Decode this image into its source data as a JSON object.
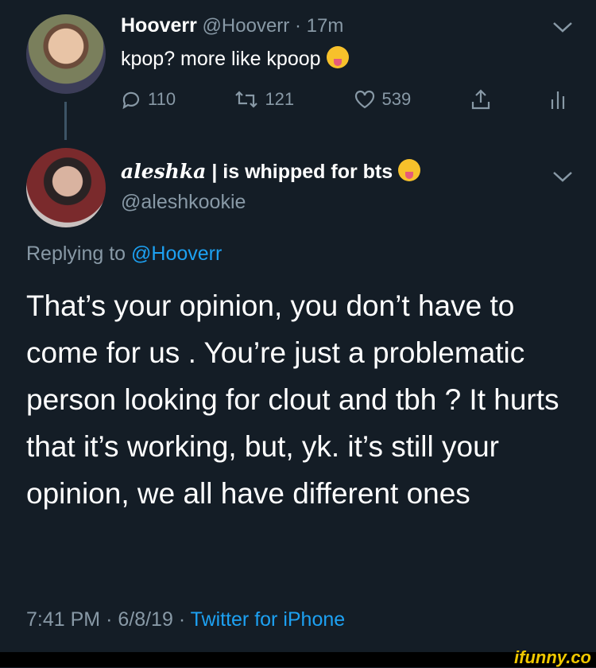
{
  "tweet1": {
    "name": "Hooverr",
    "handle": "@Hooverr",
    "separator": "·",
    "time": "17m",
    "text": "kpop? more like kpoop",
    "emoji": "rofl-emoji",
    "actions": {
      "replies": "110",
      "retweets": "121",
      "likes": "539"
    }
  },
  "tweet2": {
    "name_styled": "aleshka",
    "name_rest": "| is whipped for bts",
    "emoji": "tongue-out-emoji",
    "handle": "@aleshkookie",
    "replying_prefix": "Replying to",
    "replying_handle": "@Hooverr",
    "text": "That’s your opinion, you don’t have to come for us . You’re just a problematic person looking for clout and tbh ? It hurts that it’s working, but, yk. it’s still your opinion, we all have different ones",
    "timestamp": "7:41 PM",
    "date": "6/8/19",
    "dot": "·",
    "source": "Twitter for iPhone"
  },
  "watermark": "ifunny.co",
  "colors": {
    "background": "#141d26",
    "muted": "#8899a6",
    "accent": "#1da1f2",
    "watermark": "#f0c800"
  }
}
